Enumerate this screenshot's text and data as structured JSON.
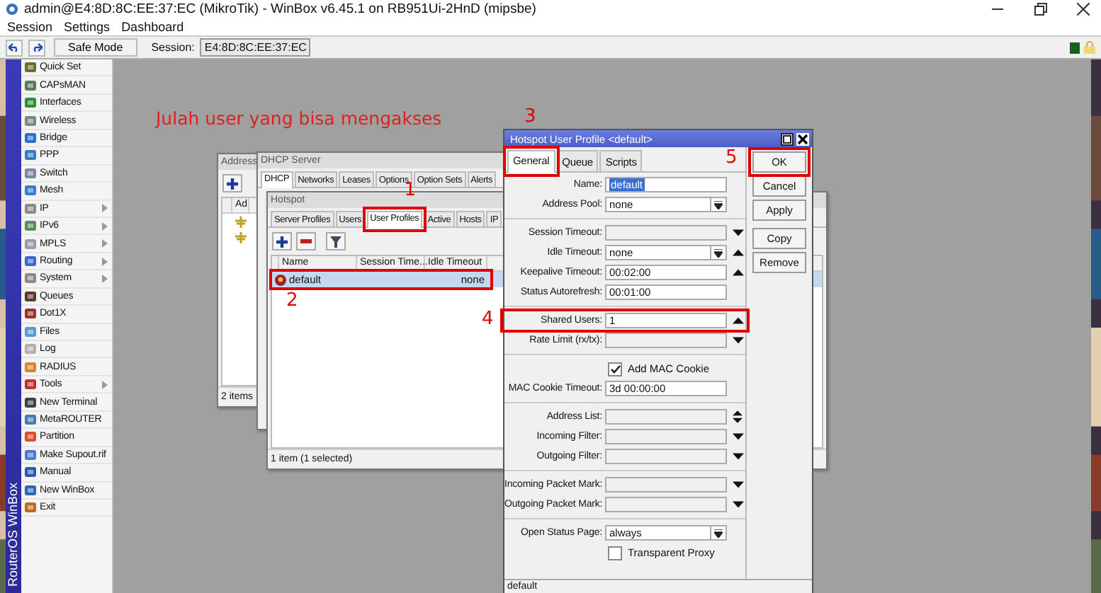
{
  "window": {
    "title": "admin@E4:8D:8C:EE:37:EC (MikroTik) - WinBox v6.45.1 on RB951Ui-2HnD (mipsbe)"
  },
  "menu": [
    "Session",
    "Settings",
    "Dashboard"
  ],
  "toolbar": {
    "safe_mode": "Safe Mode",
    "session_label": "Session:",
    "session_value": "E4:8D:8C:EE:37:EC"
  },
  "sidebar": {
    "brand": "RouterOS WinBox",
    "items": [
      {
        "label": "Quick Set",
        "submenu": false
      },
      {
        "label": "CAPsMAN",
        "submenu": false
      },
      {
        "label": "Interfaces",
        "submenu": false
      },
      {
        "label": "Wireless",
        "submenu": false
      },
      {
        "label": "Bridge",
        "submenu": false
      },
      {
        "label": "PPP",
        "submenu": false
      },
      {
        "label": "Switch",
        "submenu": false
      },
      {
        "label": "Mesh",
        "submenu": false
      },
      {
        "label": "IP",
        "submenu": true
      },
      {
        "label": "IPv6",
        "submenu": true
      },
      {
        "label": "MPLS",
        "submenu": true
      },
      {
        "label": "Routing",
        "submenu": true
      },
      {
        "label": "System",
        "submenu": true
      },
      {
        "label": "Queues",
        "submenu": false
      },
      {
        "label": "Dot1X",
        "submenu": false
      },
      {
        "label": "Files",
        "submenu": false
      },
      {
        "label": "Log",
        "submenu": false
      },
      {
        "label": "RADIUS",
        "submenu": false
      },
      {
        "label": "Tools",
        "submenu": true
      },
      {
        "label": "New Terminal",
        "submenu": false
      },
      {
        "label": "MetaROUTER",
        "submenu": false
      },
      {
        "label": "Partition",
        "submenu": false
      },
      {
        "label": "Make Supout.rif",
        "submenu": false
      },
      {
        "label": "Manual",
        "submenu": false
      },
      {
        "label": "New WinBox",
        "submenu": false
      },
      {
        "label": "Exit",
        "submenu": false
      }
    ]
  },
  "annotation": {
    "heading": "Julah user yang bisa mengakses",
    "markers": [
      {
        "label": "1"
      },
      {
        "label": "2"
      },
      {
        "label": "3"
      },
      {
        "label": "4"
      },
      {
        "label": "5"
      }
    ]
  },
  "address_window": {
    "title": "Address",
    "column": "Ad",
    "status": "2 items"
  },
  "dhcp_window": {
    "title": "DHCP Server",
    "tabs": [
      {
        "label": "DHCP",
        "selected": true
      },
      {
        "label": "Networks",
        "selected": false
      },
      {
        "label": "Leases",
        "selected": false
      },
      {
        "label": "Options",
        "selected": false
      },
      {
        "label": "Option Sets",
        "selected": false
      },
      {
        "label": "Alerts",
        "selected": false
      }
    ]
  },
  "hotspot_window": {
    "title": "Hotspot",
    "tabs": [
      {
        "label": "Server Profiles",
        "selected": false
      },
      {
        "label": "Users",
        "selected": false
      },
      {
        "label": "User Profiles",
        "selected": true
      },
      {
        "label": "Active",
        "selected": false
      },
      {
        "label": "Hosts",
        "selected": false
      },
      {
        "label": "IP",
        "selected": false
      }
    ],
    "columns": [
      "Name",
      "Session Time...",
      "Idle Timeout"
    ],
    "rows": [
      {
        "name": "default",
        "idle_timeout": "none",
        "selected": true
      }
    ],
    "status": "1 item (1 selected)"
  },
  "profile_dialog": {
    "title": "Hotspot User Profile <default>",
    "tabs": [
      {
        "label": "General",
        "selected": true
      },
      {
        "label": "Queue",
        "selected": false
      },
      {
        "label": "Scripts",
        "selected": false
      }
    ],
    "fields": [
      {
        "kind": "field",
        "label": "Name:",
        "value": "default",
        "highlighted": true,
        "arrow_up": false,
        "arrow_down": false
      },
      {
        "kind": "field",
        "label": "Address Pool:",
        "value": "none",
        "dropdown": true,
        "arrow_up": false,
        "arrow_down": false
      },
      {
        "kind": "separator"
      },
      {
        "kind": "field",
        "label": "Session Timeout:",
        "arrow_up": false,
        "arrow_down": true
      },
      {
        "kind": "field",
        "label": "Idle Timeout:",
        "value": "none",
        "dropdown": true,
        "arrow_up": true,
        "arrow_down": false
      },
      {
        "kind": "field",
        "label": "Keepalive Timeout:",
        "value": "00:02:00",
        "arrow_up": true,
        "arrow_down": false
      },
      {
        "kind": "field",
        "label": "Status Autorefresh:",
        "value": "00:01:00",
        "arrow_up": false,
        "arrow_down": false
      },
      {
        "kind": "separator"
      },
      {
        "kind": "field",
        "label": "Shared Users:",
        "value": "1",
        "arrow_up": true,
        "arrow_down": false
      },
      {
        "kind": "field",
        "label": "Rate Limit (rx/tx):",
        "arrow_up": false,
        "arrow_down": true
      },
      {
        "kind": "separator"
      },
      {
        "kind": "checkbox",
        "label": "Add MAC Cookie",
        "checked": true
      },
      {
        "kind": "field",
        "label": "MAC Cookie Timeout:",
        "value": "3d 00:00:00",
        "arrow_up": false,
        "arrow_down": false
      },
      {
        "kind": "separator"
      },
      {
        "kind": "field",
        "label": "Address List:",
        "arrow_up": true,
        "arrow_down": true
      },
      {
        "kind": "field",
        "label": "Incoming Filter:",
        "arrow_up": false,
        "arrow_down": true
      },
      {
        "kind": "field",
        "label": "Outgoing Filter:",
        "arrow_up": false,
        "arrow_down": true
      },
      {
        "kind": "separator"
      },
      {
        "kind": "field",
        "label": "Incoming Packet Mark:",
        "arrow_up": false,
        "arrow_down": true
      },
      {
        "kind": "field",
        "label": "Outgoing Packet Mark:",
        "arrow_up": false,
        "arrow_down": true
      },
      {
        "kind": "separator"
      },
      {
        "kind": "field",
        "label": "Open Status Page:",
        "value": "always",
        "dropdown": true,
        "arrow_up": false,
        "arrow_down": false
      },
      {
        "kind": "checkbox",
        "label": "Transparent Proxy",
        "checked": false
      }
    ],
    "buttons": [
      {
        "label": "OK",
        "kind": "main"
      },
      {
        "label": "Cancel",
        "kind": "main"
      },
      {
        "label": "Apply",
        "kind": "main"
      },
      {
        "label": "Copy",
        "kind": "extra"
      },
      {
        "label": "Remove",
        "kind": "main"
      }
    ],
    "status": "default"
  }
}
